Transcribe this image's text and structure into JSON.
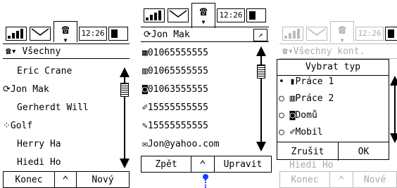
{
  "screen1": {
    "clock": "12:26",
    "filter_label": "Všechny",
    "contacts": [
      "Eric Crane",
      "Jon Mak",
      "Gerherdt Will",
      "Golf",
      "Herry Ha",
      "Hiedi Ho"
    ],
    "footer": {
      "left": "Konec",
      "right": "Nový"
    }
  },
  "screen2": {
    "clock": "12:26",
    "contact_name": "Jon Mak",
    "entries": [
      "01065555555",
      "01065555555",
      "01063555555",
      "15555555555",
      "15555555555",
      "Jon@yahoo.com"
    ],
    "footer": {
      "left": "Zpět",
      "right": "Upravit"
    }
  },
  "screen3": {
    "clock": "12:26",
    "filter_label": "Všechny kont.",
    "bg_contact": "Hiedi Ho",
    "dialog": {
      "title": "Vybrat typ",
      "options": [
        "Práce 1",
        "Práce 2",
        "Domů",
        "Mobil"
      ],
      "cancel": "Zrušit",
      "ok": "OK"
    },
    "footer": {
      "left": "Konec",
      "right": "Nové"
    }
  },
  "colors": {
    "ink": "#000000",
    "faded": "#aaaaaa",
    "pointer": "#1a3cff"
  },
  "icons": [
    "signal-icon",
    "mail-icon",
    "phone-icon",
    "battery-icon",
    "scroll-up-icon",
    "scroll-down-icon"
  ]
}
